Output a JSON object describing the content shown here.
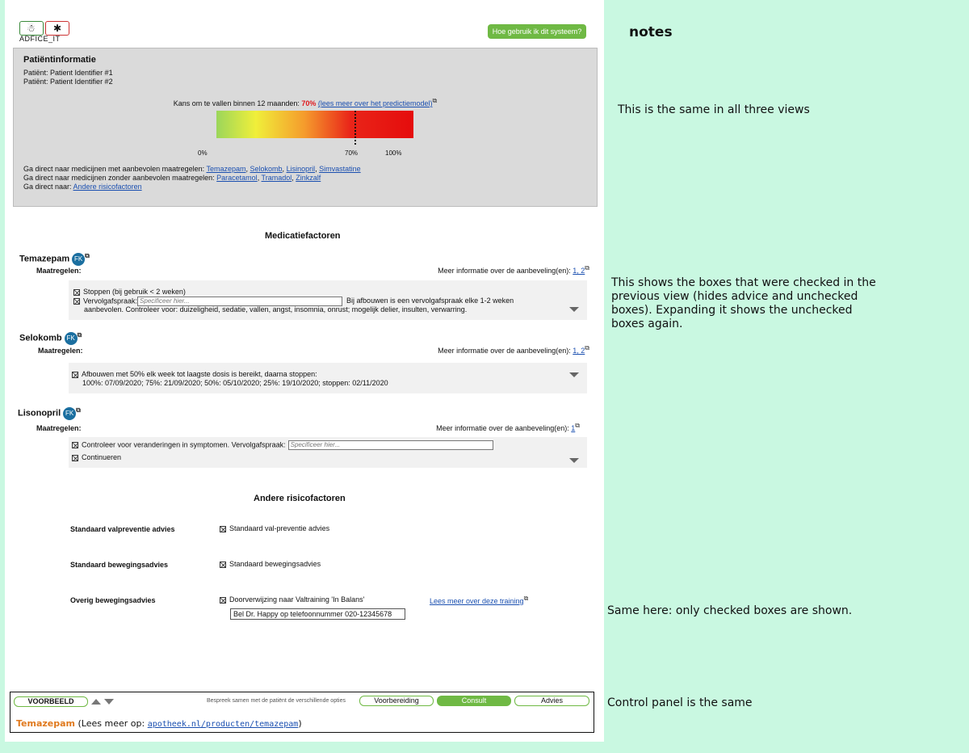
{
  "header": {
    "logo_text": "ADFICE_IT",
    "help_button": "Hoe gebruik ik dit systeem?"
  },
  "patient": {
    "title": "Patiëntinformatie",
    "line1": "Patiënt: Patient Identifier #1",
    "line2": "Patiënt: Patient Identifier #2",
    "risk_prefix": "Kans om te vallen binnen 12 maanden: ",
    "risk_value": "70%",
    "risk_link": "(lees meer over het predictiemodel)",
    "risk_fraction": 0.7,
    "tick_0": "0%",
    "tick_70": "70%",
    "tick_100": "100%",
    "goto_with_prefix": "Ga direct naar medicijnen met aanbevolen maatregelen: ",
    "goto_with": [
      "Temazepam",
      "Selokomb",
      "Lisinopril",
      "Simvastatine"
    ],
    "goto_without_prefix": "Ga direct naar medicijnen zonder aanbevolen maatregelen: ",
    "goto_without": [
      "Paracetamol",
      "Tramadol",
      "Zinkzalf"
    ],
    "goto_other_prefix": "Ga direct naar: ",
    "goto_other": "Andere risicofactoren"
  },
  "medication": {
    "title": "Medicatiefactoren",
    "maatregelen_label": "Maatregelen:",
    "meer_info_label": "Meer informatie over de aanbeveling(en): ",
    "fk_label": "FK",
    "placeholder": "Specificeer hier...",
    "meds": [
      {
        "name": "Temazepam",
        "refs": "1, 2",
        "options": [
          "Stoppen (bij gebruik < 2 weken)",
          "Vervolgafspraak:",
          "Bij afbouwen is een vervolgafspraak elke 1-2 weken",
          "aanbevolen. Controleer voor: duizeligheid, sedatie, vallen, angst, insomnia, onrust; mogelijk delier, insulten, verwarring."
        ]
      },
      {
        "name": "Selokomb",
        "refs": "1, 2",
        "options": [
          "Afbouwen met 50% elk week tot laagste dosis is bereikt, daarna stoppen:",
          "100%: 07/09/2020; 75%: 21/09/2020; 50%: 05/10/2020; 25%: 19/10/2020; stoppen: 02/11/2020"
        ]
      },
      {
        "name": "Lisonopril",
        "refs": "1",
        "options": [
          "Controleer voor veranderingen in symptomen. Vervolgafspraak:",
          "Continueren"
        ]
      }
    ]
  },
  "risk_factors": {
    "title": "Andere risicofactoren",
    "items": [
      {
        "label": "Standaard valpreventie advies",
        "option": "Standaard val-preventie advies"
      },
      {
        "label": "Standaard bewegingsadvies",
        "option": "Standaard bewegingsadvies"
      },
      {
        "label": "Overig bewegingsadvies",
        "option": "Doorverwijzing naar Valtraining 'In Balans'"
      }
    ],
    "training_link": "Lees meer over deze training",
    "phone_text": "Bel Dr. Happy op telefoonnummer 020-12345678"
  },
  "control_panel": {
    "voorbeeld": "VOORBEELD",
    "bespreek": "Bespreek samen met de patiënt de verschillende opties",
    "tabs": [
      "Voorbereiding",
      "Consult",
      "Advies"
    ],
    "active_tab": "Consult",
    "info_drug": "Temazepam",
    "info_prefix": " (Lees meer op: ",
    "info_url": "apotheek.nl/producten/temazepam",
    "info_suffix": ")"
  },
  "notes": {
    "title": "notes",
    "note1": "This is the same in all three views",
    "note2_l1": "This shows the boxes that were checked in the",
    "note2_l2": "previous view (hides  advice and unchecked",
    "note2_l3": "boxes). Expanding it shows the unchecked",
    "note2_l4": "boxes again.",
    "note3": "Same here: only checked boxes are shown.",
    "note4": "Control panel is the same"
  },
  "colors": {
    "background": "#c9f8e1",
    "accent_green": "#6fb944",
    "risk_red": "#e0191e",
    "fk_blue": "#1b6fa0",
    "drug_orange": "#e07a1f"
  }
}
